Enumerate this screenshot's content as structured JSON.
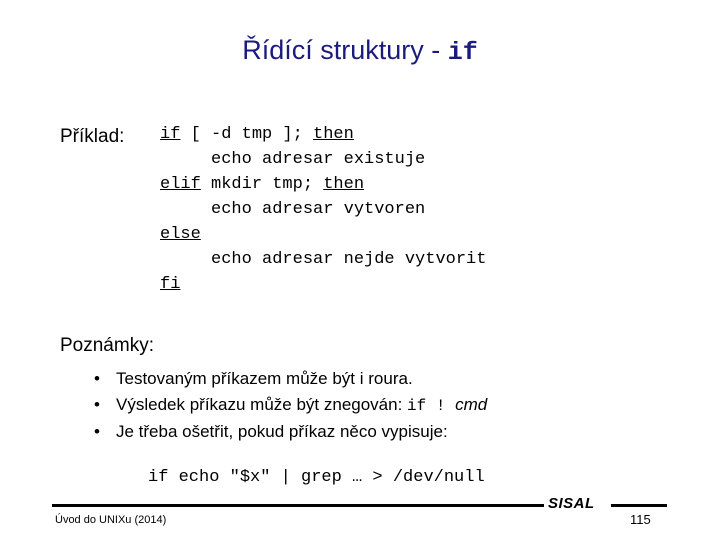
{
  "slide": {
    "background_color": "#ffffff",
    "title_color": "#1b1b7e",
    "body_color": "#000000",
    "title_text": "Řídící struktury - ",
    "title_mono": "if"
  },
  "example": {
    "label": "Příklad:",
    "code_lines": [
      [
        {
          "t": "if",
          "kw": true
        },
        {
          "t": " [ -d tmp ]; ",
          "kw": false
        },
        {
          "t": "then",
          "kw": true
        }
      ],
      [
        {
          "t": "     echo adresar existuje",
          "kw": false
        }
      ],
      [
        {
          "t": "elif",
          "kw": true
        },
        {
          "t": " mkdir tmp; ",
          "kw": false
        },
        {
          "t": "then",
          "kw": true
        }
      ],
      [
        {
          "t": "     echo adresar vytvoren",
          "kw": false
        }
      ],
      [
        {
          "t": "else",
          "kw": true
        }
      ],
      [
        {
          "t": "     echo adresar nejde vytvorit",
          "kw": false
        }
      ],
      [
        {
          "t": "fi",
          "kw": true
        }
      ]
    ]
  },
  "notes": {
    "label": "Poznámky:",
    "bullet_glyph": "•",
    "items": [
      [
        {
          "t": "Testovaným příkazem může být i roura.",
          "style": "plain"
        }
      ],
      [
        {
          "t": "Výsledek příkazu může být znegován: ",
          "style": "plain"
        },
        {
          "t": "if ! ",
          "style": "mono"
        },
        {
          "t": "cmd",
          "style": "ital"
        }
      ],
      [
        {
          "t": "Je třeba ošetřit, pokud příkaz něco vypisuje:",
          "style": "plain"
        }
      ]
    ],
    "code_line": "if echo \"$x\" | grep … > /dev/null"
  },
  "footer": {
    "note": "Úvod do UNIXu (2014)",
    "brand": "SISAL",
    "page_number": "115"
  }
}
